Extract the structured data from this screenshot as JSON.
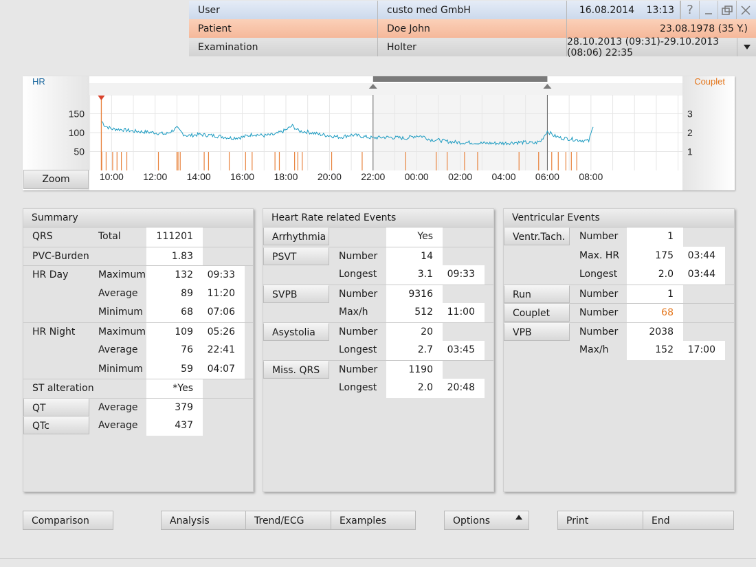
{
  "header": {
    "user_label": "User",
    "user_value": "custo med GmbH",
    "date": "16.08.2014",
    "time": "13:13",
    "help_icon": "?",
    "patient_label": "Patient",
    "patient_value": "Doe John",
    "patient_birth": "23.08.1978 (35 Y.)",
    "exam_label": "Examination",
    "exam_value": "Holter",
    "exam_period": "28.10.2013 (09:31)-29.10.2013 (08:06) 22:35"
  },
  "colors": {
    "hr_line": "#1a9ac0",
    "couplet": "#e8823c",
    "marker": "#d9432c"
  },
  "chart_data": {
    "type": "line",
    "left_label": "HR",
    "right_label": "Couplet",
    "y_ticks": [
      "150",
      "100",
      "50"
    ],
    "y_right_ticks": [
      "3",
      "2",
      "1"
    ],
    "ylim": [
      0,
      200
    ],
    "y_right_lim": [
      0,
      4
    ],
    "x_ticks": [
      "10:00",
      "12:00",
      "14:00",
      "16:00",
      "18:00",
      "20:00",
      "22:00",
      "00:00",
      "02:00",
      "04:00",
      "06:00",
      "08:00"
    ],
    "x_start_hour": 9.53,
    "x_end_hour": 32.1,
    "selection_hours": [
      22,
      30
    ],
    "series": [
      {
        "values_hr": [
          [
            9.55,
            130
          ],
          [
            9.7,
            118
          ],
          [
            10,
            110
          ],
          [
            10.5,
            108
          ],
          [
            11,
            104
          ],
          [
            11.5,
            102
          ],
          [
            12,
            100
          ],
          [
            12.5,
            96
          ],
          [
            13,
            112
          ],
          [
            13.3,
            96
          ],
          [
            13.5,
            92
          ],
          [
            14,
            95
          ],
          [
            14.5,
            93
          ],
          [
            15,
            90
          ],
          [
            15.5,
            86
          ],
          [
            16,
            88
          ],
          [
            16.5,
            96
          ],
          [
            17,
            92
          ],
          [
            17.5,
            95
          ],
          [
            18,
            107
          ],
          [
            18.3,
            118
          ],
          [
            18.6,
            104
          ],
          [
            19,
            102
          ],
          [
            19.5,
            96
          ],
          [
            20,
            92
          ],
          [
            20.5,
            88
          ],
          [
            21,
            94
          ],
          [
            21.5,
            90
          ],
          [
            22,
            86
          ],
          [
            22.5,
            88
          ],
          [
            23,
            87
          ],
          [
            23.5,
            85
          ],
          [
            24,
            92
          ],
          [
            24.3,
            90
          ],
          [
            24.6,
            82
          ],
          [
            25,
            80
          ],
          [
            25.5,
            76
          ],
          [
            26,
            74
          ],
          [
            26.5,
            74
          ],
          [
            27,
            72
          ],
          [
            27.5,
            72
          ],
          [
            28,
            72
          ],
          [
            28.5,
            74
          ],
          [
            29,
            74
          ],
          [
            29.4,
            72
          ],
          [
            29.7,
            78
          ],
          [
            30,
            104
          ],
          [
            30.3,
            92
          ],
          [
            30.6,
            86
          ],
          [
            31,
            84
          ],
          [
            31.5,
            80
          ],
          [
            31.9,
            78
          ],
          [
            32.1,
            115
          ]
        ]
      }
    ],
    "couplet_events": [
      9.55,
      9.75,
      10.05,
      10.25,
      10.45,
      10.7,
      12.15,
      13.0,
      13.05,
      13.15,
      14.25,
      14.45,
      15.4,
      16.15,
      16.45,
      17.5,
      17.7,
      18.4,
      18.55,
      18.75,
      20.1,
      21.5,
      23.5,
      24.9,
      25.4,
      26.2,
      26.8,
      28.7,
      29.6,
      30.2,
      30.5,
      30.85,
      31.1,
      31.35
    ]
  },
  "chart_zoom_label": "Zoom",
  "summary": {
    "title": "Summary",
    "qrs_label": "QRS",
    "qrs_sub": "Total",
    "qrs_val": "111201",
    "pvc_label": "PVC-Burden",
    "pvc_val": "1.83",
    "hrday_label": "HR Day",
    "hrday_rows": [
      {
        "k": "Maximum",
        "v": "132",
        "t": "09:33"
      },
      {
        "k": "Average",
        "v": "89",
        "t": "11:20"
      },
      {
        "k": "Minimum",
        "v": "68",
        "t": "07:06"
      }
    ],
    "hrnight_label": "HR Night",
    "hrnight_rows": [
      {
        "k": "Maximum",
        "v": "109",
        "t": "05:26"
      },
      {
        "k": "Average",
        "v": "76",
        "t": "22:41"
      },
      {
        "k": "Minimum",
        "v": "59",
        "t": "04:07"
      }
    ],
    "st_label": "ST alteration",
    "st_val": "*Yes",
    "qt_label": "QT",
    "qt_sub": "Average",
    "qt_val": "379",
    "qtc_label": "QTc",
    "qtc_sub": "Average",
    "qtc_val": "437"
  },
  "hr_events": {
    "title": "Heart Rate related Events",
    "arrhythmia_label": "Arrhythmia",
    "arrhythmia_val": "Yes",
    "psvt_label": "PSVT",
    "psvt_n_k": "Number",
    "psvt_n": "14",
    "psvt_l_k": "Longest",
    "psvt_l": "3.1",
    "psvt_l_t": "09:33",
    "svpb_label": "SVPB",
    "svpb_n_k": "Number",
    "svpb_n": "9316",
    "svpb_m_k": "Max/h",
    "svpb_m": "512",
    "svpb_m_t": "11:00",
    "asys_label": "Asystolia",
    "asys_n_k": "Number",
    "asys_n": "20",
    "asys_l_k": "Longest",
    "asys_l": "2.7",
    "asys_l_t": "03:45",
    "miss_label": "Miss. QRS",
    "miss_n_k": "Number",
    "miss_n": "1190",
    "miss_l_k": "Longest",
    "miss_l": "2.0",
    "miss_l_t": "20:48"
  },
  "ventricular": {
    "title": "Ventricular Events",
    "vt_label": "Ventr.Tach.",
    "vt_n_k": "Number",
    "vt_n": "1",
    "vt_max_k": "Max. HR",
    "vt_max": "175",
    "vt_max_t": "03:44",
    "vt_l_k": "Longest",
    "vt_l": "2.0",
    "vt_l_t": "03:44",
    "run_label": "Run",
    "run_n_k": "Number",
    "run_n": "1",
    "couplet_label": "Couplet",
    "couplet_n_k": "Number",
    "couplet_n": "68",
    "vpb_label": "VPB",
    "vpb_n_k": "Number",
    "vpb_n": "2038",
    "vpb_m_k": "Max/h",
    "vpb_m": "152",
    "vpb_m_t": "17:00"
  },
  "footer": {
    "comparison": "Comparison",
    "analysis": "Analysis",
    "trend": "Trend/ECG",
    "examples": "Examples",
    "options": "Options",
    "print": "Print",
    "end": "End"
  }
}
